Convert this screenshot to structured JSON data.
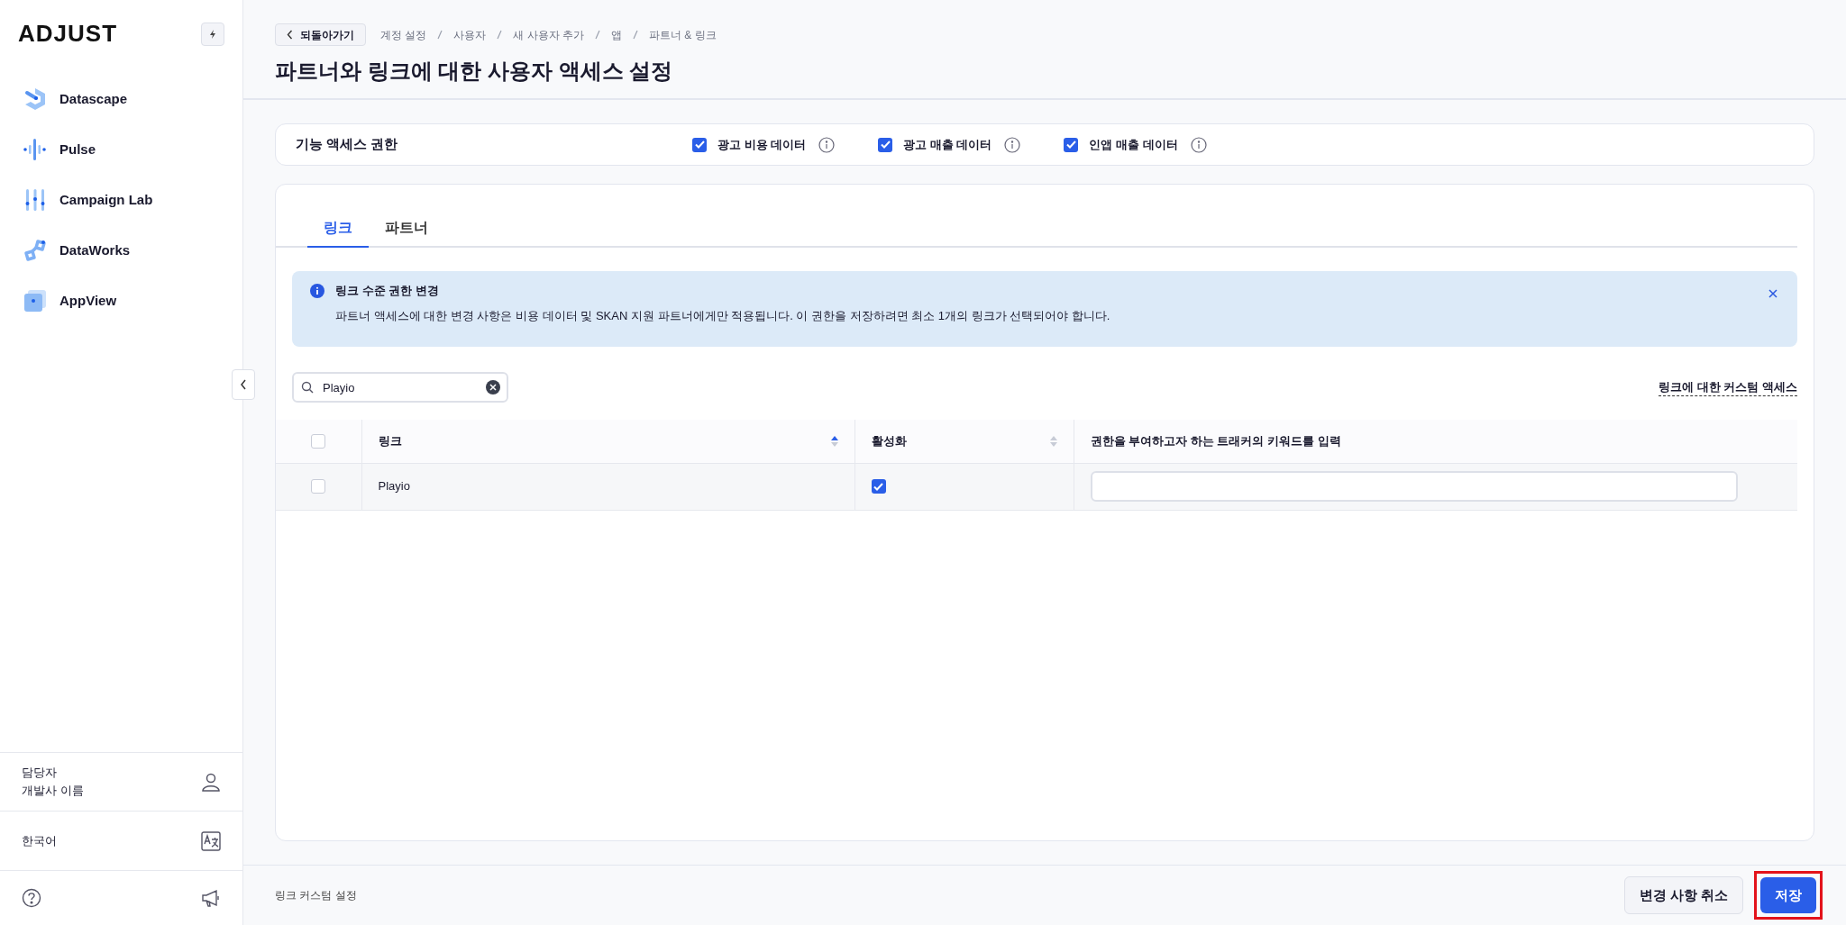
{
  "sidebar": {
    "logo": "ADJUST",
    "items": [
      {
        "label": "Datascape",
        "kind": "datascape"
      },
      {
        "label": "Pulse",
        "kind": "pulse"
      },
      {
        "label": "Campaign Lab",
        "kind": "lab"
      },
      {
        "label": "DataWorks",
        "kind": "dataworks"
      },
      {
        "label": "AppView",
        "kind": "appview"
      }
    ],
    "user": {
      "role": "담당자",
      "name": "개발사 이름"
    },
    "language": "한국어"
  },
  "header": {
    "back_button": "되돌아가기",
    "breadcrumbs": [
      "계정 설정",
      "사용자",
      "새 사용자 추가",
      "앱",
      "파트너 & 링크"
    ],
    "title": "파트너와 링크에 대한 사용자 액세스 설정"
  },
  "feature_access": {
    "label": "기능 액세스 권한",
    "options": [
      {
        "label": "광고 비용 데이터",
        "checked": true
      },
      {
        "label": "광고 매출 데이터",
        "checked": true
      },
      {
        "label": "인앱 매출 데이터",
        "checked": true
      }
    ]
  },
  "tabs": [
    {
      "label": "링크",
      "selected": true
    },
    {
      "label": "파트너",
      "selected": false
    }
  ],
  "notice": {
    "title": "링크 수준 권한 변경",
    "text": "파트너 액세스에 대한 변경 사항은 비용 데이터 및 SKAN 지원 파트너에게만 적용됩니다. 이 권한을 저장하려면 최소 1개의 링크가 선택되어야 합니다."
  },
  "search": {
    "value": "Playio"
  },
  "custom_access_link": "링크에 대한 커스텀 액세스",
  "table": {
    "all_checked": false,
    "columns": [
      "링크",
      "활성화",
      "권한을 부여하고자 하는 트래커의 키워드를 입력"
    ],
    "rows": [
      {
        "checked": false,
        "link": "Playio",
        "active": true,
        "keywords": ""
      }
    ]
  },
  "footer": {
    "label": "링크 커스텀 설정",
    "cancel_button": "변경 사항 취소",
    "save_button": "저장",
    "save_highlighted": true
  }
}
